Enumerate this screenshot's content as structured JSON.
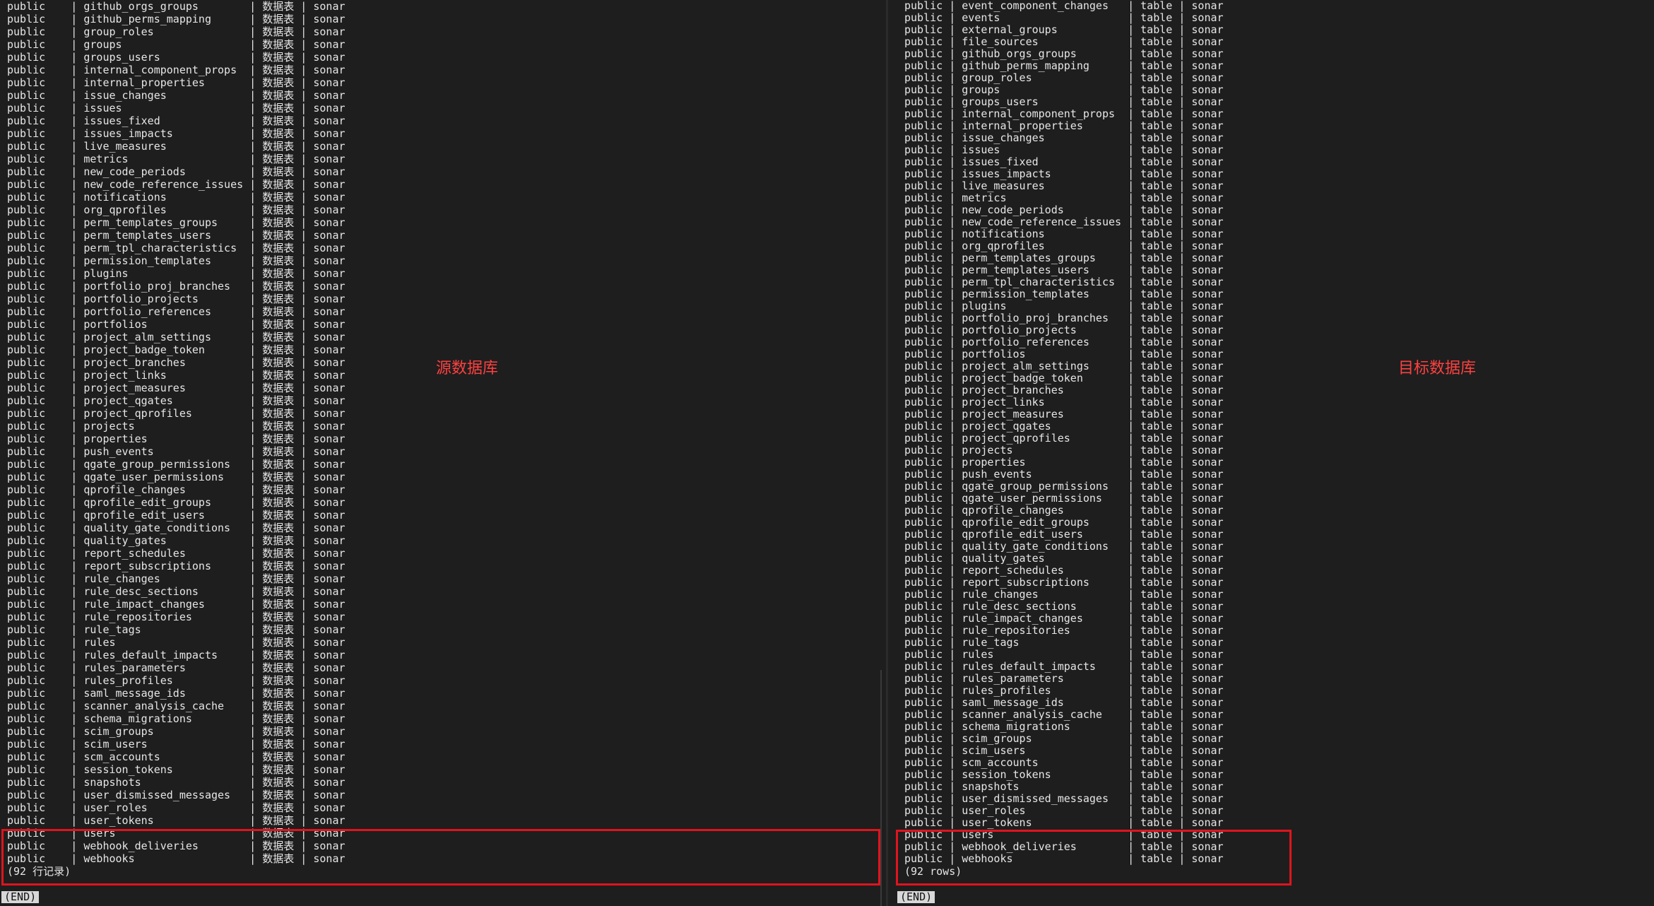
{
  "left": {
    "label": "源数据库",
    "schema": "public",
    "type_text": "数据表",
    "owner": "sonar",
    "rows": [
      "github_orgs_groups",
      "github_perms_mapping",
      "group_roles",
      "groups",
      "groups_users",
      "internal_component_props",
      "internal_properties",
      "issue_changes",
      "issues",
      "issues_fixed",
      "issues_impacts",
      "live_measures",
      "metrics",
      "new_code_periods",
      "new_code_reference_issues",
      "notifications",
      "org_qprofiles",
      "perm_templates_groups",
      "perm_templates_users",
      "perm_tpl_characteristics",
      "permission_templates",
      "plugins",
      "portfolio_proj_branches",
      "portfolio_projects",
      "portfolio_references",
      "portfolios",
      "project_alm_settings",
      "project_badge_token",
      "project_branches",
      "project_links",
      "project_measures",
      "project_qgates",
      "project_qprofiles",
      "projects",
      "properties",
      "push_events",
      "qgate_group_permissions",
      "qgate_user_permissions",
      "qprofile_changes",
      "qprofile_edit_groups",
      "qprofile_edit_users",
      "quality_gate_conditions",
      "quality_gates",
      "report_schedules",
      "report_subscriptions",
      "rule_changes",
      "rule_desc_sections",
      "rule_impact_changes",
      "rule_repositories",
      "rule_tags",
      "rules",
      "rules_default_impacts",
      "rules_parameters",
      "rules_profiles",
      "saml_message_ids",
      "scanner_analysis_cache",
      "schema_migrations",
      "scim_groups",
      "scim_users",
      "scm_accounts",
      "session_tokens",
      "snapshots",
      "user_dismissed_messages",
      "user_roles",
      "user_tokens",
      "users",
      "webhook_deliveries",
      "webhooks"
    ],
    "footer": "(92 行记录)",
    "end": "(END)"
  },
  "right": {
    "label": "目标数据库",
    "schema": "public",
    "type_text": "table",
    "owner": "sonar",
    "rows": [
      "event_component_changes",
      "events",
      "external_groups",
      "file_sources",
      "github_orgs_groups",
      "github_perms_mapping",
      "group_roles",
      "groups",
      "groups_users",
      "internal_component_props",
      "internal_properties",
      "issue_changes",
      "issues",
      "issues_fixed",
      "issues_impacts",
      "live_measures",
      "metrics",
      "new_code_periods",
      "new_code_reference_issues",
      "notifications",
      "org_qprofiles",
      "perm_templates_groups",
      "perm_templates_users",
      "perm_tpl_characteristics",
      "permission_templates",
      "plugins",
      "portfolio_proj_branches",
      "portfolio_projects",
      "portfolio_references",
      "portfolios",
      "project_alm_settings",
      "project_badge_token",
      "project_branches",
      "project_links",
      "project_measures",
      "project_qgates",
      "project_qprofiles",
      "projects",
      "properties",
      "push_events",
      "qgate_group_permissions",
      "qgate_user_permissions",
      "qprofile_changes",
      "qprofile_edit_groups",
      "qprofile_edit_users",
      "quality_gate_conditions",
      "quality_gates",
      "report_schedules",
      "report_subscriptions",
      "rule_changes",
      "rule_desc_sections",
      "rule_impact_changes",
      "rule_repositories",
      "rule_tags",
      "rules",
      "rules_default_impacts",
      "rules_parameters",
      "rules_profiles",
      "saml_message_ids",
      "scanner_analysis_cache",
      "schema_migrations",
      "scim_groups",
      "scim_users",
      "scm_accounts",
      "session_tokens",
      "snapshots",
      "user_dismissed_messages",
      "user_roles",
      "user_tokens",
      "users",
      "webhook_deliveries",
      "webhooks"
    ],
    "footer": "(92 rows)",
    "end": "(END)"
  }
}
